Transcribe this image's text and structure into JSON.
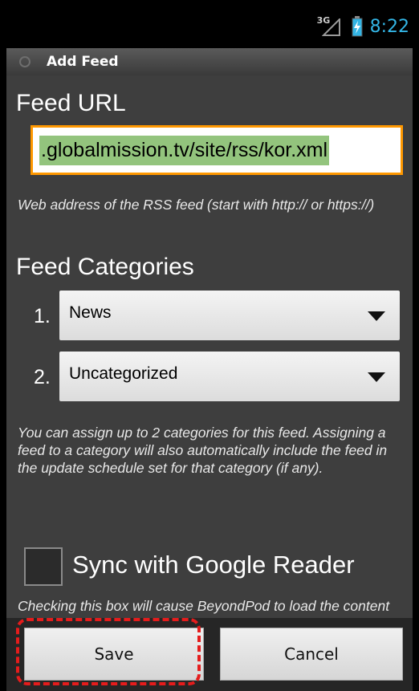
{
  "status_bar": {
    "network_label": "3G",
    "time": "8:22",
    "icons": [
      "signal-icon",
      "battery-charging-icon"
    ]
  },
  "dialog": {
    "title": "Add Feed",
    "title_icon": "dialog-circle-icon"
  },
  "feed_url": {
    "heading": "Feed URL",
    "value": ".globalmission.tv/site/rss/kor.xml",
    "help": "Web address of the RSS feed (start with http:// or https://)"
  },
  "categories": {
    "heading": "Feed Categories",
    "items": [
      {
        "number": "1.",
        "selected": "News"
      },
      {
        "number": "2.",
        "selected": "Uncategorized"
      }
    ],
    "help": "You can assign up to 2 categories for this feed. Assigning a feed to a category will also automatically include the feed in the update schedule set for that category (if any)."
  },
  "sync": {
    "label": "Sync with Google Reader",
    "checked": false,
    "help": "Checking this box will cause BeyondPod to load the content of this feed from Google Reader"
  },
  "buttons": {
    "save": "Save",
    "cancel": "Cancel"
  },
  "colors": {
    "accent_orange": "#ff9800",
    "selection_green": "#93c47d",
    "clock_blue": "#33b5e5",
    "highlight_red": "#e51c1c"
  }
}
